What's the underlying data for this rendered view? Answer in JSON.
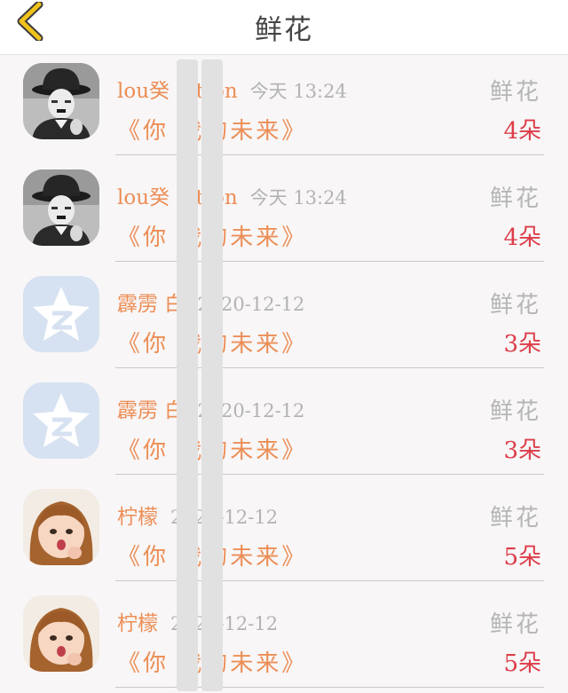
{
  "header": {
    "title": "鲜花",
    "back_icon": "chevron-left-icon",
    "back_color": "#f1c21c"
  },
  "rows": [
    {
      "avatar": "charlie-chaplin",
      "name": "lou癸 uitton",
      "time": "今天 13:24",
      "gift": "鲜花",
      "song": "《你 我的未来》",
      "count": "4朵"
    },
    {
      "avatar": "charlie-chaplin",
      "name": "lou癸 uitton",
      "time": "今天 13:24",
      "gift": "鲜花",
      "song": "《你 我的未来》",
      "count": "4朵"
    },
    {
      "avatar": "qzone-star",
      "name": "霹雳 白",
      "time": "2020-12-12",
      "gift": "鲜花",
      "song": "《你 我的未来》",
      "count": "3朵"
    },
    {
      "avatar": "qzone-star",
      "name": "霹雳 白",
      "time": "2020-12-12",
      "gift": "鲜花",
      "song": "《你 我的未来》",
      "count": "3朵"
    },
    {
      "avatar": "little-girl",
      "name": "柠檬",
      "time": "2020-12-12",
      "gift": "鲜花",
      "song": "《你 我的未来》",
      "count": "5朵"
    },
    {
      "avatar": "little-girl",
      "name": "柠檬",
      "time": "2020-12-12",
      "gift": "鲜花",
      "song": "《你 我的未来》",
      "count": "5朵"
    }
  ],
  "colors": {
    "name": "#ec8e56",
    "count": "#dc3d49",
    "muted": "#b5b5b5",
    "background": "#f8f6f7"
  }
}
